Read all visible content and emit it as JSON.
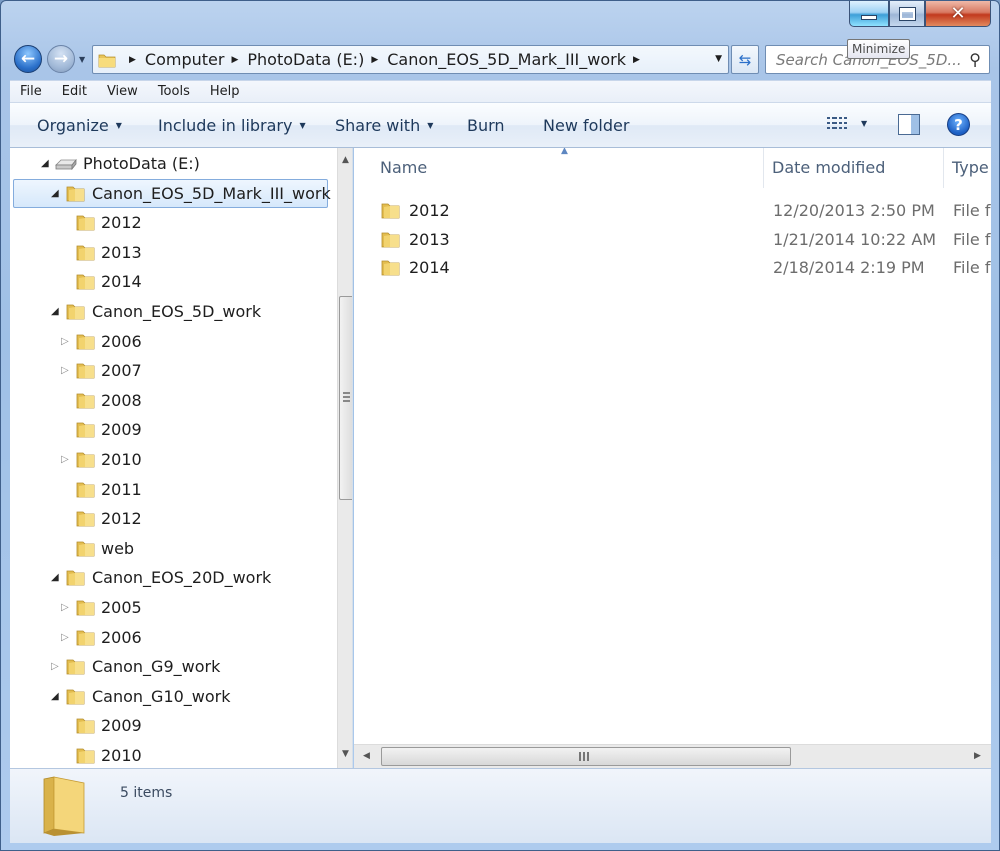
{
  "window": {
    "tooltip": "Minimize",
    "close_glyph": "✕"
  },
  "nav": {
    "back_glyph": "←",
    "forward_glyph": "→",
    "breadcrumbs": [
      "Computer",
      "PhotoData (E:)",
      "Canon_EOS_5D_Mark_III_work"
    ],
    "search_placeholder": "Search Canon_EOS_5D..."
  },
  "menu": [
    "File",
    "Edit",
    "View",
    "Tools",
    "Help"
  ],
  "toolbar": {
    "organize": "Organize",
    "include_in_library": "Include in library",
    "share_with": "Share with",
    "burn": "Burn",
    "new_folder": "New folder",
    "help_glyph": "?"
  },
  "tree": [
    {
      "label": "PhotoData (E:)",
      "level": 0,
      "twisty": "expanded",
      "icon": "drive-icon"
    },
    {
      "label": "Canon_EOS_5D_Mark_III_work",
      "level": 1,
      "twisty": "expanded",
      "selected": true
    },
    {
      "label": "2012",
      "level": 2,
      "twisty": "none"
    },
    {
      "label": "2013",
      "level": 2,
      "twisty": "none"
    },
    {
      "label": "2014",
      "level": 2,
      "twisty": "none"
    },
    {
      "label": "Canon_EOS_5D_work",
      "level": 1,
      "twisty": "expanded"
    },
    {
      "label": "2006",
      "level": 2,
      "twisty": "collapsed"
    },
    {
      "label": "2007",
      "level": 2,
      "twisty": "collapsed"
    },
    {
      "label": "2008",
      "level": 2,
      "twisty": "none"
    },
    {
      "label": "2009",
      "level": 2,
      "twisty": "none"
    },
    {
      "label": "2010",
      "level": 2,
      "twisty": "collapsed"
    },
    {
      "label": "2011",
      "level": 2,
      "twisty": "none"
    },
    {
      "label": "2012",
      "level": 2,
      "twisty": "none"
    },
    {
      "label": "web",
      "level": 2,
      "twisty": "none"
    },
    {
      "label": "Canon_EOS_20D_work",
      "level": 1,
      "twisty": "expanded"
    },
    {
      "label": "2005",
      "level": 2,
      "twisty": "collapsed"
    },
    {
      "label": "2006",
      "level": 2,
      "twisty": "collapsed"
    },
    {
      "label": "Canon_G9_work",
      "level": 1,
      "twisty": "collapsed"
    },
    {
      "label": "Canon_G10_work",
      "level": 1,
      "twisty": "expanded"
    },
    {
      "label": "2009",
      "level": 2,
      "twisty": "none"
    },
    {
      "label": "2010",
      "level": 2,
      "twisty": "none"
    }
  ],
  "columns": {
    "name": "Name",
    "date_modified": "Date modified",
    "type": "Type"
  },
  "files": [
    {
      "name": "2012",
      "date": "12/20/2013 2:50 PM",
      "type": "File fo"
    },
    {
      "name": "2013",
      "date": "1/21/2014 10:22 AM",
      "type": "File fo"
    },
    {
      "name": "2014",
      "date": "2/18/2014 2:19 PM",
      "type": "File fo"
    }
  ],
  "status": {
    "item_count": "5 items"
  }
}
